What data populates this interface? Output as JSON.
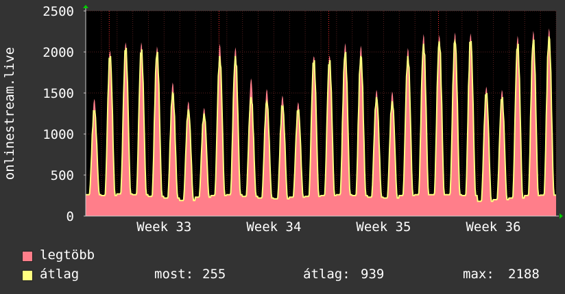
{
  "chart_data": {
    "type": "area",
    "ylabel": "onlinestream.live",
    "ylim": [
      0,
      2500
    ],
    "yticks": [
      0,
      500,
      1000,
      1500,
      2000,
      2500
    ],
    "xticks": [
      "Week 33",
      "Week 34",
      "Week 35",
      "Week 36"
    ],
    "grid": true,
    "legend_position": "bottom-left",
    "colors": {
      "background": "#333333",
      "plot": "#000000",
      "max": "#ff7e8a",
      "avg": "#ffff80",
      "grid": "#5a1f1f"
    },
    "daily_peaks_max": [
      1430,
      2020,
      2120,
      2120,
      2070,
      1630,
      1400,
      1320,
      2100,
      2060,
      1680,
      1550,
      1470,
      1390,
      1950,
      1960,
      2110,
      2080,
      1540,
      1520,
      2050,
      2220,
      2210,
      2240,
      2230,
      1580,
      1540,
      2200,
      2260,
      2290
    ],
    "daily_peaks_avg": [
      1300,
      1950,
      2050,
      2030,
      2000,
      1500,
      1300,
      1250,
      1950,
      1950,
      1450,
      1400,
      1350,
      1300,
      1900,
      1900,
      2000,
      1950,
      1450,
      1400,
      1950,
      2100,
      2130,
      2150,
      2150,
      1500,
      1450,
      2100,
      2150,
      2188
    ],
    "daily_troughs": [
      260,
      250,
      270,
      260,
      240,
      220,
      190,
      230,
      250,
      260,
      240,
      220,
      210,
      230,
      240,
      250,
      260,
      250,
      230,
      220,
      250,
      260,
      260,
      260,
      250,
      180,
      200,
      220,
      250,
      255
    ],
    "series": [
      {
        "name": "legtöbb",
        "color": "#ff7e8a"
      },
      {
        "name": "átlag",
        "color": "#ffff80"
      }
    ],
    "stats": {
      "now_label": "most:",
      "now": "255",
      "avg_label": "átlag:",
      "avg": "939",
      "max_label": "max:",
      "max": "2188"
    }
  }
}
